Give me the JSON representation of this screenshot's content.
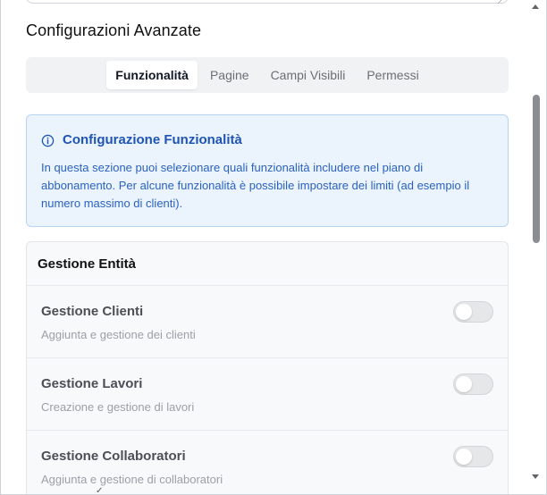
{
  "section": {
    "title": "Configurazioni Avanzate"
  },
  "tabs": [
    {
      "label": "Funzionalità",
      "active": true
    },
    {
      "label": "Pagine",
      "active": false
    },
    {
      "label": "Campi Visibili",
      "active": false
    },
    {
      "label": "Permessi",
      "active": false
    }
  ],
  "info": {
    "title": "Configurazione Funzionalità",
    "text": "In questa sezione puoi selezionare quali funzionalità includere nel piano di abbonamento. Per alcune funzionalità è possibile impostare dei limiti (ad esempio il numero massimo di clienti).",
    "icon": "info-circle-icon"
  },
  "group": {
    "title": "Gestione Entità",
    "features": [
      {
        "name": "Gestione Clienti",
        "description": "Aggiunta e gestione dei clienti",
        "enabled": false
      },
      {
        "name": "Gestione Lavori",
        "description": "Creazione e gestione di lavori",
        "enabled": false
      },
      {
        "name": "Gestione Collaboratori",
        "description": "Aggiunta e gestione di collaboratori",
        "enabled": false
      }
    ]
  },
  "colors": {
    "info_bg": "#ebf3fd",
    "info_accent": "#1e55b3",
    "toggle_off": "#e6e7e9"
  }
}
